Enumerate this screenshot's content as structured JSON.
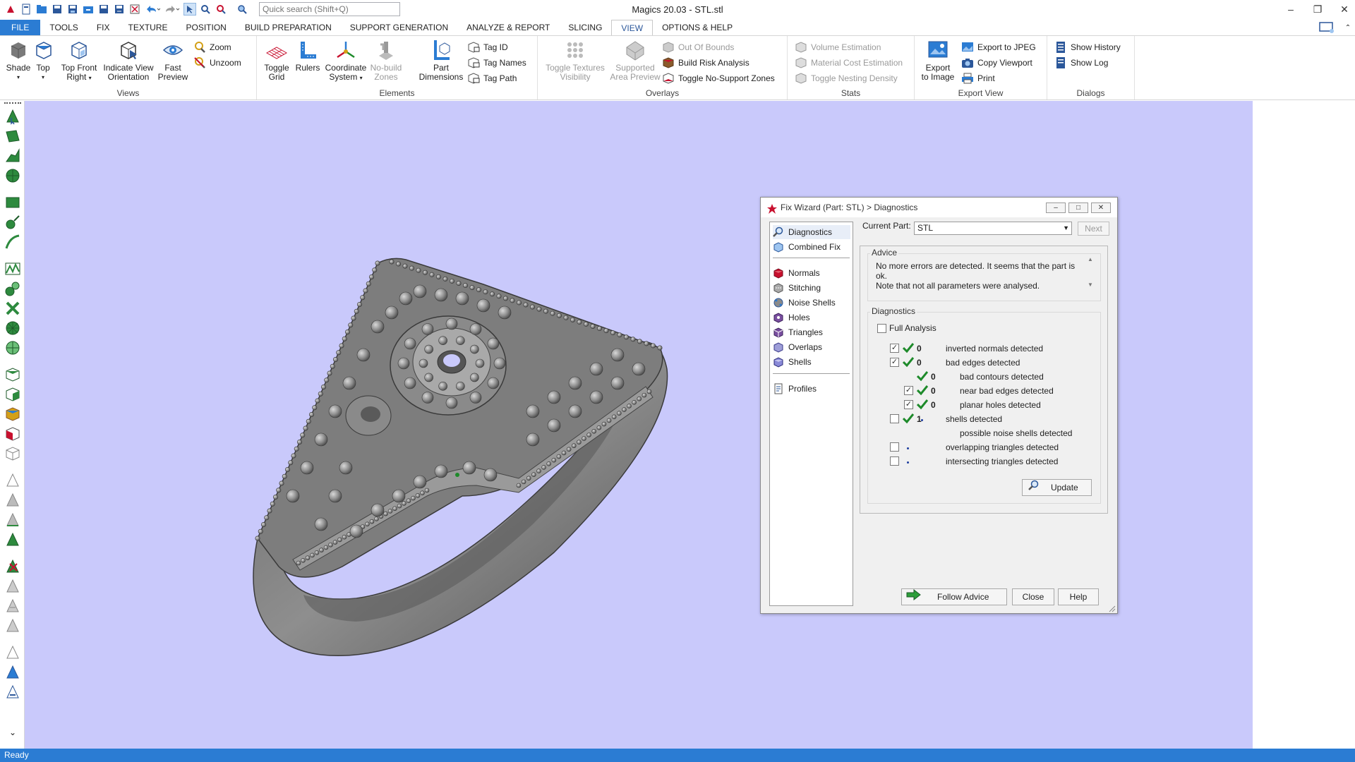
{
  "window": {
    "title": "Magics 20.03 - STL.stl",
    "search_placeholder": "Quick search (Shift+Q)"
  },
  "tabs": [
    "FILE",
    "TOOLS",
    "FIX",
    "TEXTURE",
    "POSITION",
    "BUILD PREPARATION",
    "SUPPORT GENERATION",
    "ANALYZE & REPORT",
    "SLICING",
    "VIEW",
    "OPTIONS & HELP"
  ],
  "active_tab": "VIEW",
  "ribbon": {
    "views": {
      "label": "Views",
      "shade": "Shade",
      "top": "Top",
      "top_front_right_1": "Top Front",
      "top_front_right_2": "Right",
      "indicate_1": "Indicate View",
      "indicate_2": "Orientation",
      "fast_1": "Fast",
      "fast_2": "Preview",
      "zoom": "Zoom",
      "unzoom": "Unzoom"
    },
    "elements": {
      "label": "Elements",
      "toggle_grid_1": "Toggle",
      "toggle_grid_2": "Grid",
      "rulers": "Rulers",
      "coord_1": "Coordinate",
      "coord_2": "System",
      "nobuild_1": "No-build",
      "nobuild_2": "Zones",
      "partdim_1": "Part",
      "partdim_2": "Dimensions",
      "tag_id": "Tag ID",
      "tag_names": "Tag Names",
      "tag_path": "Tag Path"
    },
    "overlays": {
      "label": "Overlays",
      "toggle_tex_1": "Toggle Textures",
      "toggle_tex_2": "Visibility",
      "supp_prev_1": "Supported",
      "supp_prev_2": "Area Preview",
      "out_of_bounds": "Out Of Bounds",
      "build_risk": "Build Risk Analysis",
      "no_support": "Toggle No-Support Zones"
    },
    "stats": {
      "label": "Stats",
      "volume": "Volume Estimation",
      "material": "Material Cost Estimation",
      "nesting": "Toggle Nesting Density"
    },
    "export": {
      "label": "Export View",
      "export_img_1": "Export",
      "export_img_2": "to Image",
      "export_jpeg": "Export to JPEG",
      "copy_viewport": "Copy Viewport",
      "print": "Print"
    },
    "dialogs": {
      "label": "Dialogs",
      "show_history": "Show History",
      "show_log": "Show Log"
    }
  },
  "status": "Ready",
  "dialog": {
    "title": "Fix Wizard (Part: STL) > Diagnostics",
    "nav": [
      {
        "label": "Diagnostics",
        "icon": "magnifier-icon"
      },
      {
        "label": "Combined Fix",
        "icon": "combined-fix-icon"
      },
      {
        "label": "Normals",
        "icon": "normals-icon"
      },
      {
        "label": "Stitching",
        "icon": "stitching-icon"
      },
      {
        "label": "Noise Shells",
        "icon": "noise-shells-icon"
      },
      {
        "label": "Holes",
        "icon": "holes-icon"
      },
      {
        "label": "Triangles",
        "icon": "triangles-icon"
      },
      {
        "label": "Overlaps",
        "icon": "overlaps-icon"
      },
      {
        "label": "Shells",
        "icon": "shells-icon"
      },
      {
        "label": "Profiles",
        "icon": "profiles-icon"
      }
    ],
    "current_part_label": "Current Part:",
    "current_part_value": "STL",
    "next_label": "Next",
    "advice_label": "Advice",
    "advice_line1": "No more errors are detected. It seems that the part is ok.",
    "advice_line2": "Note that not all parameters were analysed.",
    "diagnostics_label": "Diagnostics",
    "full_analysis": "Full Analysis",
    "rows": [
      {
        "text": "inverted normals detected",
        "count": "0"
      },
      {
        "text": "bad edges detected",
        "count": "0"
      },
      {
        "text": "bad contours detected",
        "count": "0"
      },
      {
        "text": "near bad edges detected",
        "count": "0"
      },
      {
        "text": "planar holes detected",
        "count": "0"
      },
      {
        "text": "shells detected",
        "count": "1"
      },
      {
        "text": "possible noise shells detected",
        "count": ""
      },
      {
        "text": "overlapping triangles detected",
        "count": ""
      },
      {
        "text": "intersecting triangles detected",
        "count": ""
      }
    ],
    "update_label": "Update",
    "follow_advice": "Follow Advice",
    "close": "Close",
    "help": "Help"
  },
  "colors": {
    "viewport_bg": "#c9c9fb",
    "accent": "#2b7cd3",
    "check_green": "#1d8a2a",
    "part_gray": "#8a8a8a"
  }
}
